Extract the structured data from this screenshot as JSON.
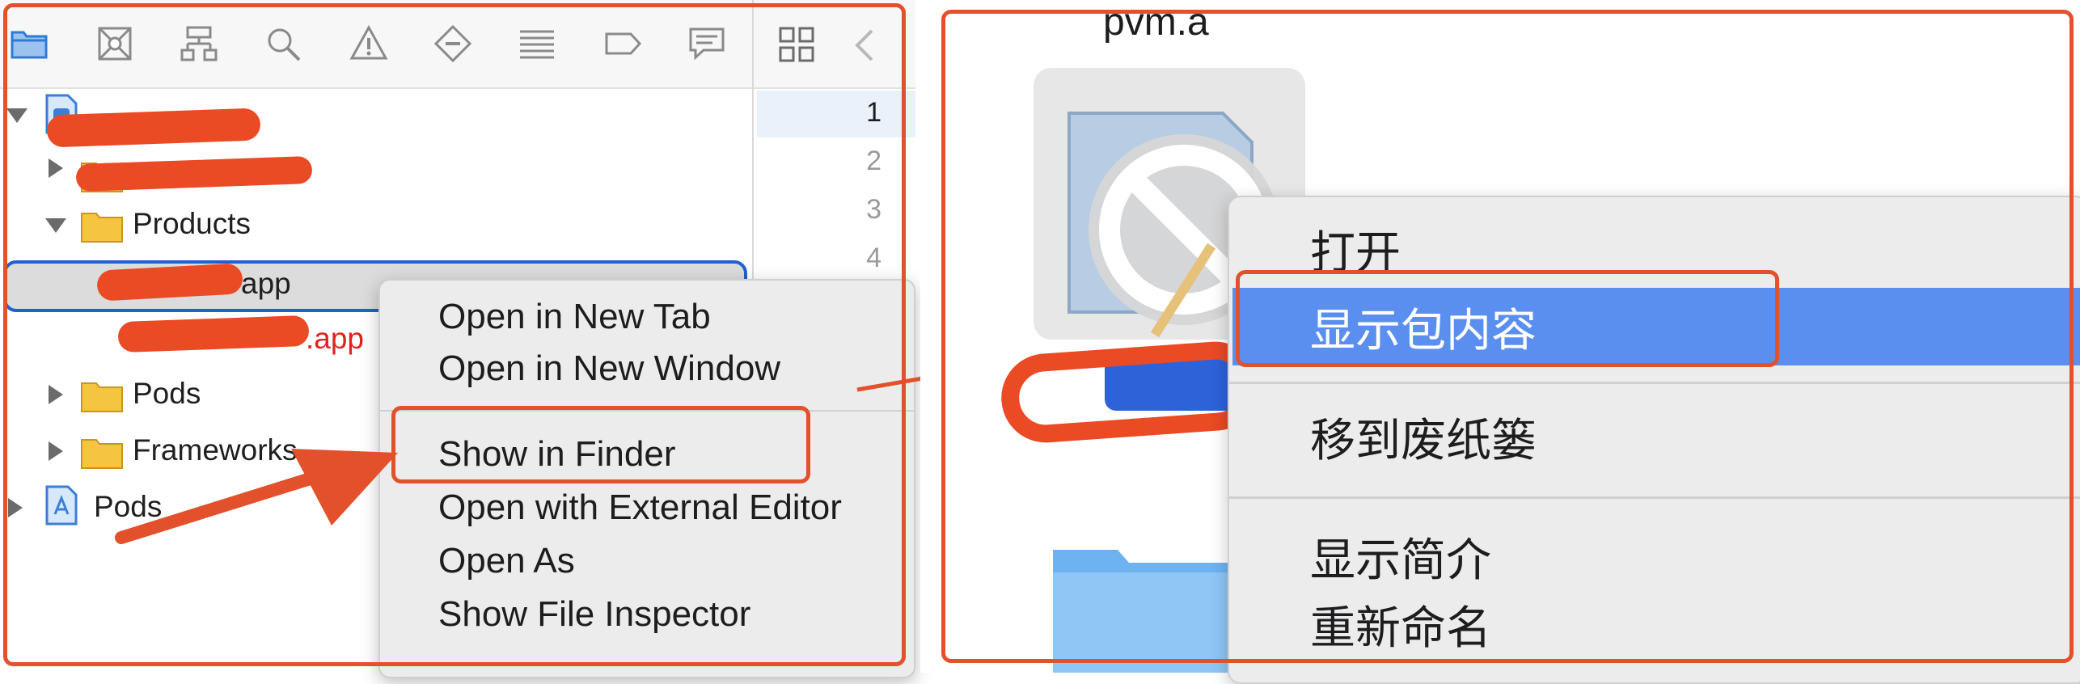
{
  "xcode": {
    "toolbar_icons": [
      "folder-icon",
      "xmark-box-icon",
      "hierarchy-icon",
      "magnifier-icon",
      "warning-icon",
      "diamond-minus-icon",
      "list-lines-icon",
      "tag-icon",
      "speech-bubble-icon"
    ],
    "tree": {
      "products": "Products",
      "app_suffix": "app",
      "app_suffix_red": ".app",
      "pods_folder": "Pods",
      "frameworks": "Frameworks",
      "pods_project": "Pods"
    },
    "line_numbers": [
      "1",
      "2",
      "3",
      "4"
    ],
    "context_menu": {
      "items": [
        "Open in New Tab",
        "Open in New Window",
        "Show in Finder",
        "Open with External Editor",
        "Open As",
        "Show File Inspector"
      ]
    }
  },
  "finder": {
    "file_name": "pvm.a",
    "context_menu": {
      "items": [
        "打开",
        "显示包内容",
        "移到废纸篓",
        "显示简介",
        "重新命名"
      ]
    }
  },
  "colors": {
    "annotation": "#e2512c",
    "selection_blue": "#5a8ff0",
    "redaction": "#ea4a24"
  }
}
